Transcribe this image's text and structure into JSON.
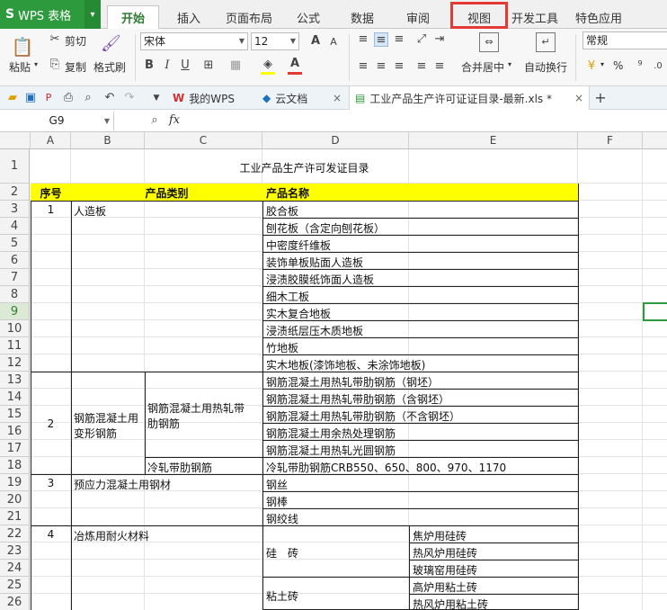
{
  "app": {
    "logo": "S",
    "name": "WPS 表格",
    "drop": "▾"
  },
  "tabs": [
    "开始",
    "插入",
    "页面布局",
    "公式",
    "数据",
    "审阅",
    "视图",
    "开发工具",
    "特色应用"
  ],
  "ribbon": {
    "paste": "粘贴",
    "cut": "剪切",
    "copy": "复制",
    "format_painter": "格式刷",
    "font_name": "宋体",
    "font_size": "12",
    "merge_center": "合并居中",
    "wrap_text": "自动换行",
    "number_format": "常规",
    "percent": "%"
  },
  "doc_tabs": {
    "mywps": "我的WPS",
    "cloud": "云文档",
    "file": "工业产品生产许可证证目录-最新.xls *",
    "close": "×",
    "add": "+"
  },
  "formula_bar": {
    "cell_ref": "G9",
    "fx": "fx",
    "value": ""
  },
  "columns": [
    "A",
    "B",
    "C",
    "D",
    "E",
    "F"
  ],
  "rows": [
    "1",
    "2",
    "3",
    "4",
    "5",
    "6",
    "7",
    "8",
    "9",
    "10",
    "11",
    "12",
    "13",
    "14",
    "15",
    "16",
    "17",
    "18",
    "19",
    "20",
    "21",
    "22",
    "23",
    "24",
    "25",
    "26"
  ],
  "sheet": {
    "title": "工业产品生产许可发证目录",
    "header_seq": "序号",
    "header_category": "产品类别",
    "header_product": "产品名称",
    "s1_no": "1",
    "s1_cat": "人造板",
    "s1_items": [
      "胶合板",
      "刨花板（含定向刨花板）",
      "中密度纤维板",
      "装饰单板贴面人造板",
      "浸渍胶膜纸饰面人造板",
      "细木工板",
      "实木复合地板",
      "浸渍纸层压木质地板",
      "竹地板",
      "实木地板(漆饰地板、未涂饰地板)"
    ],
    "s2_no": "2",
    "s2_cat_line1": "钢筋混凝土用",
    "s2_cat_line2": "变形钢筋",
    "s2_sub1_line1": "钢筋混凝土用热轧带",
    "s2_sub1_line2": "肋钢筋",
    "s2_sub2": "冷轧带肋钢筋",
    "s2_items": [
      "钢筋混凝土用热轧带肋钢筋（钢坯）",
      "钢筋混凝土用热轧带肋钢筋（含钢坯）",
      "钢筋混凝土用热轧带肋钢筋（不含钢坯）",
      "钢筋混凝土用余热处理钢筋",
      "钢筋混凝土用热轧光圆钢筋",
      "冷轧带肋钢筋CRB550、650、800、970、1170"
    ],
    "s3_no": "3",
    "s3_cat": "预应力混凝土用钢材",
    "s3_items": [
      "钢丝",
      "钢棒",
      "钢绞线"
    ],
    "s4_no": "4",
    "s4_cat": "冶炼用耐火材料",
    "s4_sub1": "硅　砖",
    "s4_sub2": "粘土砖",
    "s4_items": [
      "焦炉用硅砖",
      "热风炉用硅砖",
      "玻璃窑用硅砖",
      "高炉用粘土砖",
      "热风炉用粘土砖"
    ]
  },
  "colors": {
    "accent": "#2e9a3e",
    "header_fill": "#ffff00",
    "highlight": "#e53935"
  }
}
